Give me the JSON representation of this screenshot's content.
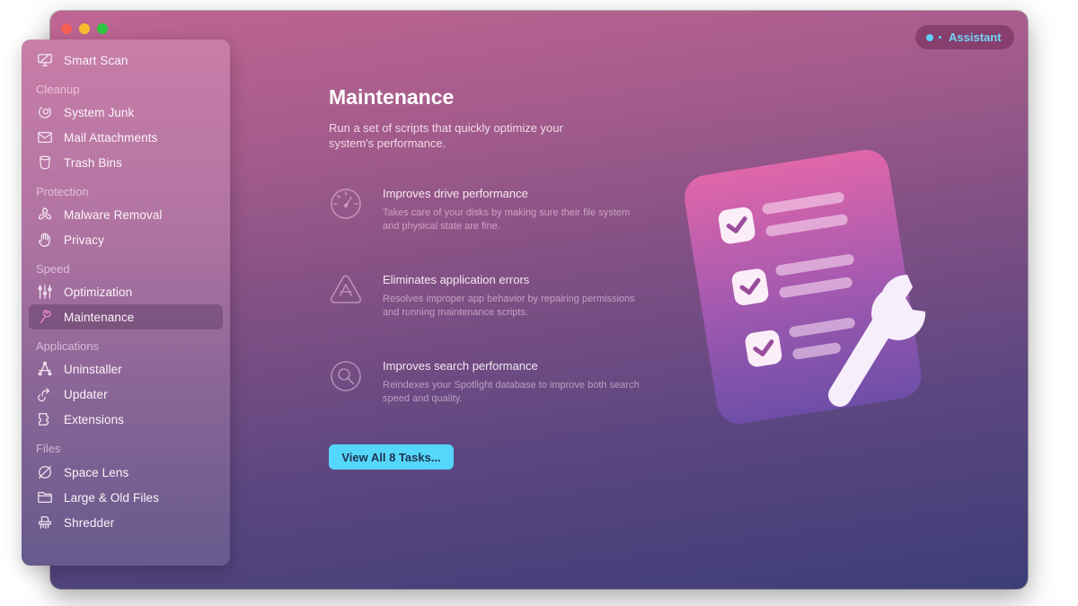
{
  "window": {
    "traffic_lights": [
      "close",
      "minimize",
      "zoom"
    ]
  },
  "assistant": {
    "label": "Assistant",
    "accent": "#5fd0f4"
  },
  "sidebar": {
    "top_item": {
      "label": "Smart Scan",
      "icon": "monitor-scan-icon"
    },
    "sections": [
      {
        "label": "Cleanup",
        "items": [
          {
            "label": "System Junk",
            "icon": "system-junk-icon"
          },
          {
            "label": "Mail Attachments",
            "icon": "mail-icon"
          },
          {
            "label": "Trash Bins",
            "icon": "trash-bin-icon"
          }
        ]
      },
      {
        "label": "Protection",
        "items": [
          {
            "label": "Malware Removal",
            "icon": "biohazard-icon"
          },
          {
            "label": "Privacy",
            "icon": "hand-icon"
          }
        ]
      },
      {
        "label": "Speed",
        "items": [
          {
            "label": "Optimization",
            "icon": "sliders-icon"
          },
          {
            "label": "Maintenance",
            "icon": "wrench-icon",
            "active": true
          }
        ]
      },
      {
        "label": "Applications",
        "items": [
          {
            "label": "Uninstaller",
            "icon": "app-uninstall-icon"
          },
          {
            "label": "Updater",
            "icon": "update-arrow-icon"
          },
          {
            "label": "Extensions",
            "icon": "puzzle-icon"
          }
        ]
      },
      {
        "label": "Files",
        "items": [
          {
            "label": "Space Lens",
            "icon": "planet-icon"
          },
          {
            "label": "Large & Old Files",
            "icon": "folder-icon"
          },
          {
            "label": "Shredder",
            "icon": "shredder-icon"
          }
        ]
      }
    ]
  },
  "main": {
    "title": "Maintenance",
    "subtitle": "Run a set of scripts that quickly optimize your system's performance.",
    "features": [
      {
        "icon": "gauge-icon",
        "title": "Improves drive performance",
        "description": "Takes care of your disks by making sure their file system and physical state are fine."
      },
      {
        "icon": "app-triangle-icon",
        "title": "Eliminates application errors",
        "description": "Resolves improper app behavior by repairing permissions and running maintenance scripts."
      },
      {
        "icon": "search-icon",
        "title": "Improves search performance",
        "description": "Reindexes your Spotlight database to improve both search speed and quality."
      }
    ],
    "cta_label": "View All 8 Tasks...",
    "cta_color": "#55d6fb"
  }
}
